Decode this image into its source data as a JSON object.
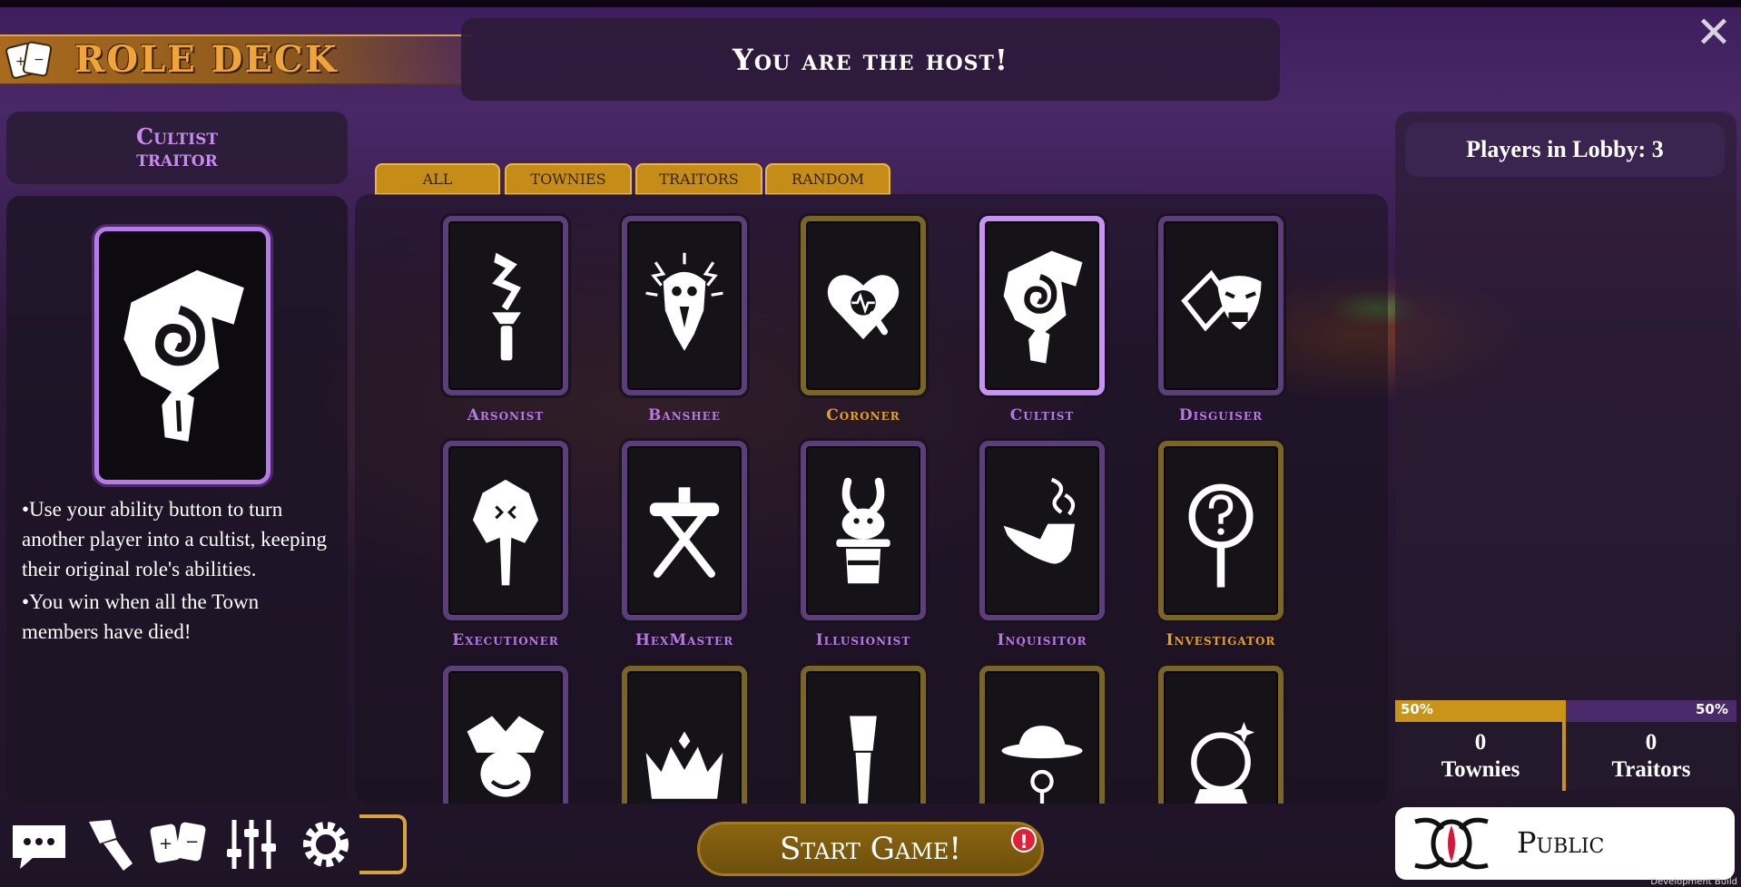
{
  "header": {
    "title": "ROLE DECK",
    "banner": "You are the host!",
    "close_label": "✕"
  },
  "selected_role": {
    "name": "Cultist",
    "faction": "traitor",
    "description": [
      "•Use your ability button to turn another player into a cultist, keeping their original role's abilities.",
      "•You win when all the Town members have died!"
    ]
  },
  "tabs": [
    {
      "label": "ALL"
    },
    {
      "label": "TOWNIES"
    },
    {
      "label": "TRAITORS"
    },
    {
      "label": "RANDOM"
    }
  ],
  "roles": [
    {
      "name": "Arsonist",
      "icon": "torch-icon",
      "faction": "traitor"
    },
    {
      "name": "Banshee",
      "icon": "banshee-icon",
      "faction": "traitor"
    },
    {
      "name": "Coroner",
      "icon": "heart-magnifier-icon",
      "faction": "townie"
    },
    {
      "name": "Cultist",
      "icon": "cultist-hood-icon",
      "faction": "traitor",
      "selected": true
    },
    {
      "name": "Disguiser",
      "icon": "masks-icon",
      "faction": "traitor"
    },
    {
      "name": "Executioner",
      "icon": "axe-icon",
      "faction": "traitor"
    },
    {
      "name": "HexMaster",
      "icon": "crossed-sticks-icon",
      "faction": "traitor"
    },
    {
      "name": "Illusionist",
      "icon": "rabbit-hat-icon",
      "faction": "traitor"
    },
    {
      "name": "Inquisitor",
      "icon": "pipe-icon",
      "faction": "traitor"
    },
    {
      "name": "Investigator",
      "icon": "question-magnifier-icon",
      "faction": "townie"
    },
    {
      "name": "",
      "icon": "jester-icon",
      "faction": "traitor"
    },
    {
      "name": "",
      "icon": "crown-icon",
      "faction": "townie"
    },
    {
      "name": "",
      "icon": "brush-icon",
      "faction": "townie"
    },
    {
      "name": "",
      "icon": "detective-hat-icon",
      "faction": "townie"
    },
    {
      "name": "",
      "icon": "crystal-ball-icon",
      "faction": "townie"
    }
  ],
  "lobby": {
    "players_label": "Players in Lobby: 3",
    "town_pct": "50%",
    "traitor_pct": "50%",
    "town_share": 0.5,
    "townies_count": "0",
    "townies_label": "Townies",
    "traitors_count": "0",
    "traitors_label": "Traitors"
  },
  "actions": {
    "start_label": "Start Game!",
    "start_alert": "!",
    "visibility_label": "Public"
  },
  "toolbar": {
    "icons": [
      "chat-icon",
      "paintbrush-icon",
      "cards-icon",
      "sliders-icon",
      "gear-icon"
    ]
  },
  "footer": {
    "build_label": "Development Build"
  },
  "colors": {
    "traitor": "#b47ae0",
    "townie": "#e0a030",
    "accent_gold": "#c58d18",
    "background": "#2c1838"
  }
}
